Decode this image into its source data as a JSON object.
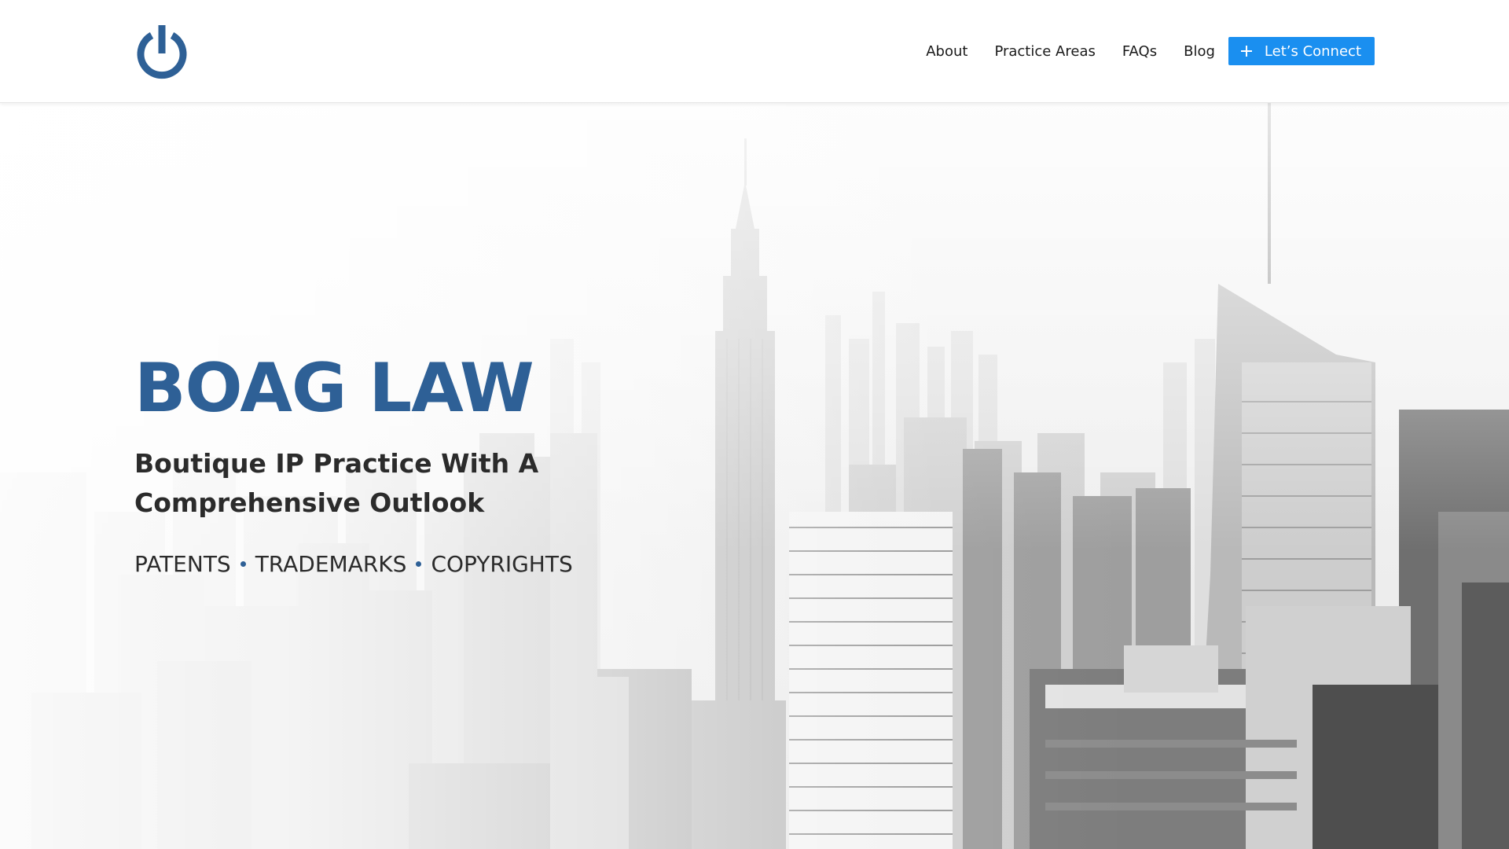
{
  "brand": {
    "logo_icon": "power-icon",
    "logo_color": "#2e6096"
  },
  "nav": {
    "items": [
      {
        "label": "About"
      },
      {
        "label": "Practice Areas"
      },
      {
        "label": "FAQs"
      },
      {
        "label": "Blog"
      }
    ],
    "cta": {
      "label": "Let’s Connect",
      "icon": "plus-icon",
      "color": "#1a8ff0"
    }
  },
  "hero": {
    "title": "BOAG LAW",
    "subtitle": "Boutique IP Practice With A Comprehensive Outlook",
    "services": [
      "PATENTS",
      "TRADEMARKS",
      "COPYRIGHTS"
    ],
    "background": "new-york-skyline-grayscale-photo",
    "title_color": "#2e6096",
    "bullet_color": "#2e6096"
  }
}
